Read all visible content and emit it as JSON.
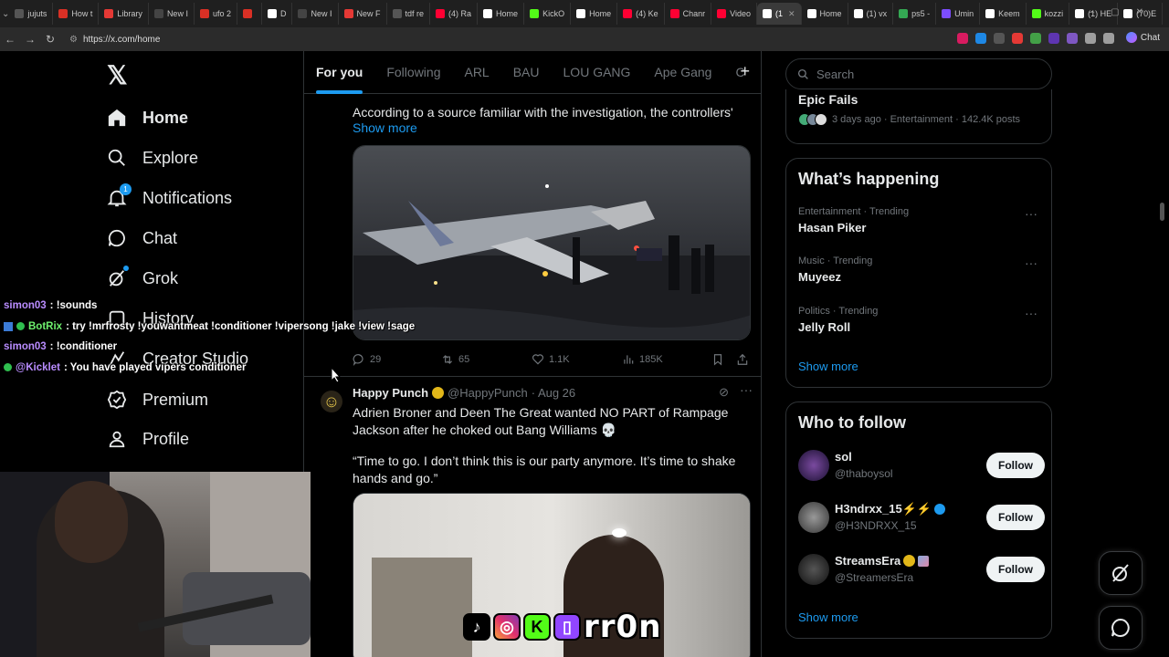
{
  "browser": {
    "tabs": [
      {
        "label": "jujuts",
        "color": "#555555"
      },
      {
        "label": "How t",
        "color": "#d93025"
      },
      {
        "label": "Library",
        "color": "#e53935"
      },
      {
        "label": "New I",
        "color": "#444444"
      },
      {
        "label": "ufo 2",
        "color": "#d93025"
      },
      {
        "label": "",
        "color": "#d93025"
      },
      {
        "label": "D",
        "color": "#ffffff"
      },
      {
        "label": "New I",
        "color": "#444444"
      },
      {
        "label": "New F",
        "color": "#e53935"
      },
      {
        "label": "tdf re",
        "color": "#555555"
      },
      {
        "label": "(4) Ra",
        "color": "#ff0033"
      },
      {
        "label": "Home",
        "color": "#ffffff"
      },
      {
        "label": "KickO",
        "color": "#53fc18"
      },
      {
        "label": "Home",
        "color": "#ffffff"
      },
      {
        "label": "(4) Ke",
        "color": "#ff0033"
      },
      {
        "label": "Chanr",
        "color": "#ff0033"
      },
      {
        "label": "Video",
        "color": "#ff0033"
      },
      {
        "label": "(1",
        "color": "#ffffff",
        "active": true
      },
      {
        "label": "Home",
        "color": "#ffffff"
      },
      {
        "label": "(1) vx",
        "color": "#ffffff"
      },
      {
        "label": "ps5 -",
        "color": "#34a853"
      },
      {
        "label": "Umin",
        "color": "#7c4dff"
      },
      {
        "label": "Keem",
        "color": "#ffffff"
      },
      {
        "label": "kozzi",
        "color": "#53fc18"
      },
      {
        "label": "(1) HE",
        "color": "#ffffff"
      },
      {
        "label": "(70)E",
        "color": "#ffffff"
      }
    ],
    "url": "https://x.com/home",
    "chat_label": "Chat",
    "extension_colors": [
      "#d81b60",
      "#1e88e5",
      "#555555",
      "#e53935",
      "#43a047",
      "#5e35b1",
      "#7e57c2",
      "#9e9e9e",
      "#9e9e9e"
    ]
  },
  "nav": {
    "items": [
      {
        "label": "Home",
        "icon": "home-icon"
      },
      {
        "label": "Explore",
        "icon": "search-icon"
      },
      {
        "label": "Notifications",
        "icon": "bell-icon",
        "badge": "1"
      },
      {
        "label": "Chat",
        "icon": "chat-icon"
      },
      {
        "label": "Grok",
        "icon": "grok-icon"
      },
      {
        "label": "History",
        "icon": "history-icon"
      },
      {
        "label": "Creator Studio",
        "icon": "creator-studio-icon"
      },
      {
        "label": "Premium",
        "icon": "premium-icon"
      },
      {
        "label": "Profile",
        "icon": "profile-icon"
      }
    ]
  },
  "chat_overlay": [
    {
      "user": "simon03",
      "message": " : !sounds",
      "style": "purple"
    },
    {
      "user": "BotRix",
      "message": " : try !mrfrosty !youwantmeat !conditioner !vipersong !jake !view !sage",
      "style": "green",
      "badges": true
    },
    {
      "user": "simon03",
      "message": " : !conditioner",
      "style": "purple"
    },
    {
      "user": "@Kicklet",
      "message": " : You have played vipers conditioner",
      "style": "purple",
      "badges": true
    }
  ],
  "feed": {
    "tabs": [
      "For you",
      "Following",
      "ARL",
      "BAU",
      "LOU GANG",
      "Ape Gang",
      "C"
    ],
    "post1": {
      "text": "According to a source familiar with the investigation, the controllers'",
      "show_more": "Show more",
      "replies": "29",
      "reposts": "65",
      "likes": "1.1K",
      "views": "185K"
    },
    "post2": {
      "author": "Happy Punch",
      "handle": "@HappyPunch",
      "date": "· Aug 26",
      "text1": "Adrien Broner and Deen The Great wanted NO PART of Rampage Jackson after he choked out Bang Williams 💀",
      "text2": "“Time to go. I don’t think this is our party anymore. It’s time to shake hands and go.”"
    }
  },
  "overlay_brand": {
    "name": "rr0n"
  },
  "sidebar": {
    "search_placeholder": "Search",
    "epic": {
      "title": "Epic Fails",
      "meta": "3 days ago · Entertainment · 142.4K posts"
    },
    "happening": {
      "title": "What’s happening",
      "trends": [
        {
          "category": "Entertainment · Trending",
          "topic": "Hasan Piker"
        },
        {
          "category": "Music · Trending",
          "topic": "Muyeez"
        },
        {
          "category": "Politics · Trending",
          "topic": "Jelly Roll"
        }
      ],
      "show_more": "Show more"
    },
    "who_to_follow": {
      "title": "Who to follow",
      "accounts": [
        {
          "name": "sol",
          "handle": "@thaboysol",
          "button": "Follow"
        },
        {
          "name": "H3ndrxx_15⚡⚡",
          "handle": "@H3NDRXX_15",
          "button": "Follow",
          "verified": true
        },
        {
          "name": "StreamsEra",
          "handle": "@StreamersEra",
          "button": "Follow",
          "gold": true
        }
      ],
      "show_more": "Show more"
    }
  }
}
